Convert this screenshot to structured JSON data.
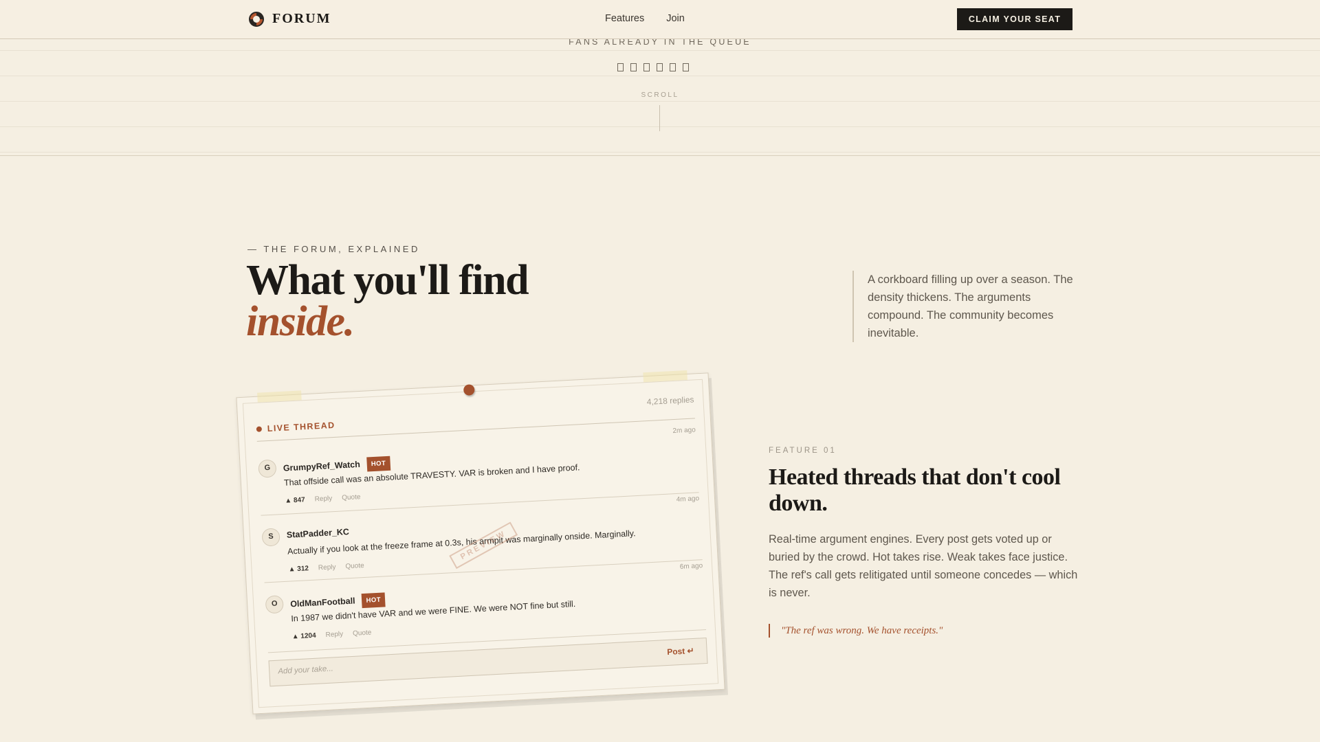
{
  "nav": {
    "brand": "FORUM",
    "links": [
      "Features",
      "Join"
    ],
    "cta_label": "CLAIM YOUR SEAT"
  },
  "hero": {
    "queue_label": "FANS ALREADY IN THE QUEUE",
    "scroll_label": "SCROLL"
  },
  "section": {
    "eyebrow": "— THE FORUM, EXPLAINED",
    "title_line1": "What you'll find",
    "title_line2": "inside.",
    "intro": "A corkboard filling up over a season. The density thickens. The arguments compound. The community becomes inevitable."
  },
  "thread_card": {
    "live_label": "LIVE THREAD",
    "replies": "4,218 replies",
    "stamp": "PREVIEW",
    "posts": [
      {
        "initial": "G",
        "user": "GrumpyRef_Watch",
        "badge": "HOT",
        "text": "That offside call was an absolute TRAVESTY. VAR is broken and I have proof.",
        "time": "2m ago",
        "votes": "▲ 847",
        "reply": "Reply",
        "quote": "Quote"
      },
      {
        "initial": "S",
        "user": "StatPadder_KC",
        "badge": "",
        "text": "Actually if you look at the freeze frame at 0.3s, his armpit was marginally onside. Marginally.",
        "time": "4m ago",
        "votes": "▲ 312",
        "reply": "Reply",
        "quote": "Quote"
      },
      {
        "initial": "O",
        "user": "OldManFootball",
        "badge": "HOT",
        "text": "In 1987 we didn't have VAR and we were FINE. We were NOT fine but still.",
        "time": "6m ago",
        "votes": "▲ 1204",
        "reply": "Reply",
        "quote": "Quote"
      }
    ],
    "composer_placeholder": "Add your take...",
    "post_button": "Post ↵"
  },
  "feature": {
    "label": "FEATURE 01",
    "title": "Heated threads that don't cool down.",
    "body": "Real-time argument engines. Every post gets voted up or buried by the crowd. Hot takes rise. Weak takes face justice. The ref's call gets relitigated until someone concedes — which is never.",
    "quote": "\"The ref was wrong. We have receipts.\""
  },
  "colors": {
    "background": "#f5efe2",
    "accent": "#a4512d",
    "ink": "#1c1a17"
  }
}
